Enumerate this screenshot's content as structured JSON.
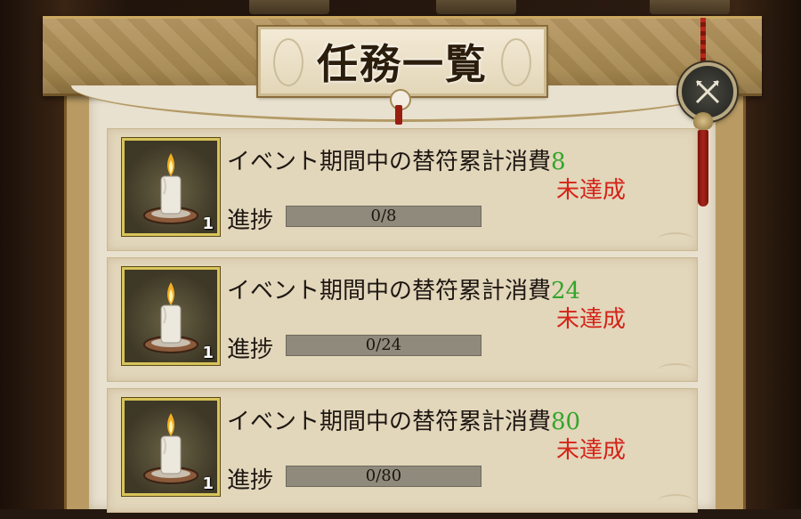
{
  "window": {
    "title": "任務一覧"
  },
  "close_button": {
    "icon": "close-icon"
  },
  "missions": [
    {
      "icon": "candle-icon",
      "quantity": "1",
      "description": "イベント期間中の替符累計消費",
      "target": "8",
      "status": "未達成",
      "progress_label": "進捗",
      "progress_text": "0/8",
      "progress_fraction": 0
    },
    {
      "icon": "candle-icon",
      "quantity": "1",
      "description": "イベント期間中の替符累計消費",
      "target": "24",
      "status": "未達成",
      "progress_label": "進捗",
      "progress_text": "0/24",
      "progress_fraction": 0
    },
    {
      "icon": "candle-icon",
      "quantity": "1",
      "description": "イベント期間中の替符累計消費",
      "target": "80",
      "status": "未達成",
      "progress_label": "進捗",
      "progress_text": "0/80",
      "progress_fraction": 0
    }
  ],
  "colors": {
    "target_green": "#33a52b",
    "status_red": "#d42418",
    "progress_bar_bg": "#8f8a7c",
    "icon_frame_gold": "#d8c45a"
  }
}
